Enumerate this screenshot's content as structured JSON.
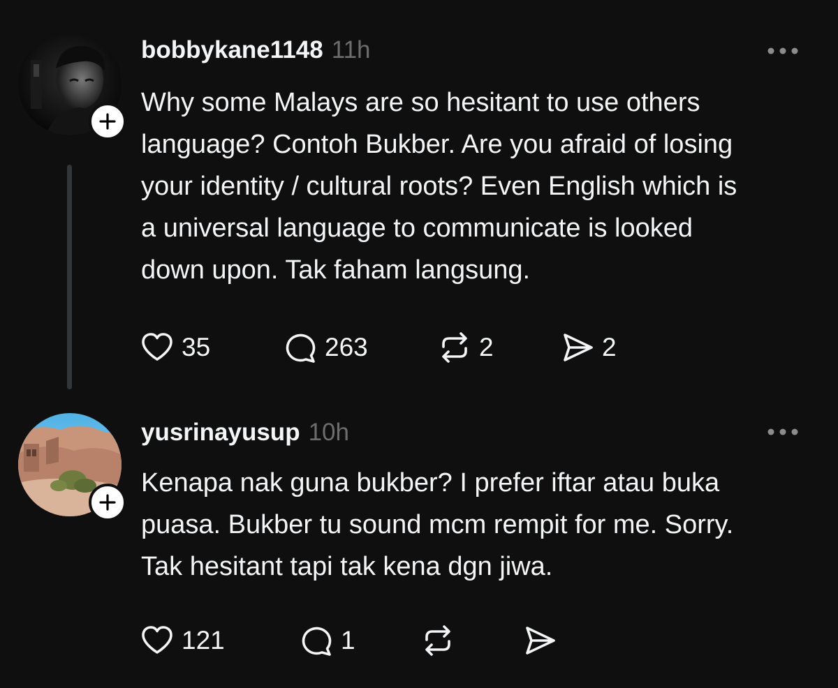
{
  "posts": [
    {
      "username": "bobbykane1148",
      "time": "11h",
      "text": "Why some Malays are so hesitant to use others\nlanguage? Contoh Bukber. Are you afraid of losing\nyour identity / cultural roots? Even English which is\na universal language to communicate is looked\ndown upon. Tak faham langsung.",
      "likes": "35",
      "replies": "263",
      "reposts": "2",
      "shares": "2"
    },
    {
      "username": "yusrinayusup",
      "time": "10h",
      "text": "Kenapa nak guna bukber? I prefer iftar atau buka\npuasa. Bukber tu sound mcm rempit for me. Sorry.\nTak hesitant tapi tak kena dgn jiwa.",
      "likes": "121",
      "replies": "1",
      "reposts": "",
      "shares": ""
    }
  ],
  "icons": {
    "like": "heart-icon",
    "reply": "comment-icon",
    "repost": "repost-icon",
    "share": "send-icon",
    "more": "more-horizontal-icon",
    "follow": "plus-icon"
  },
  "colors": {
    "background": "#0f0f0f",
    "text": "#f3f5f7",
    "secondary": "#6d6d6d",
    "thread_line": "#333638"
  }
}
